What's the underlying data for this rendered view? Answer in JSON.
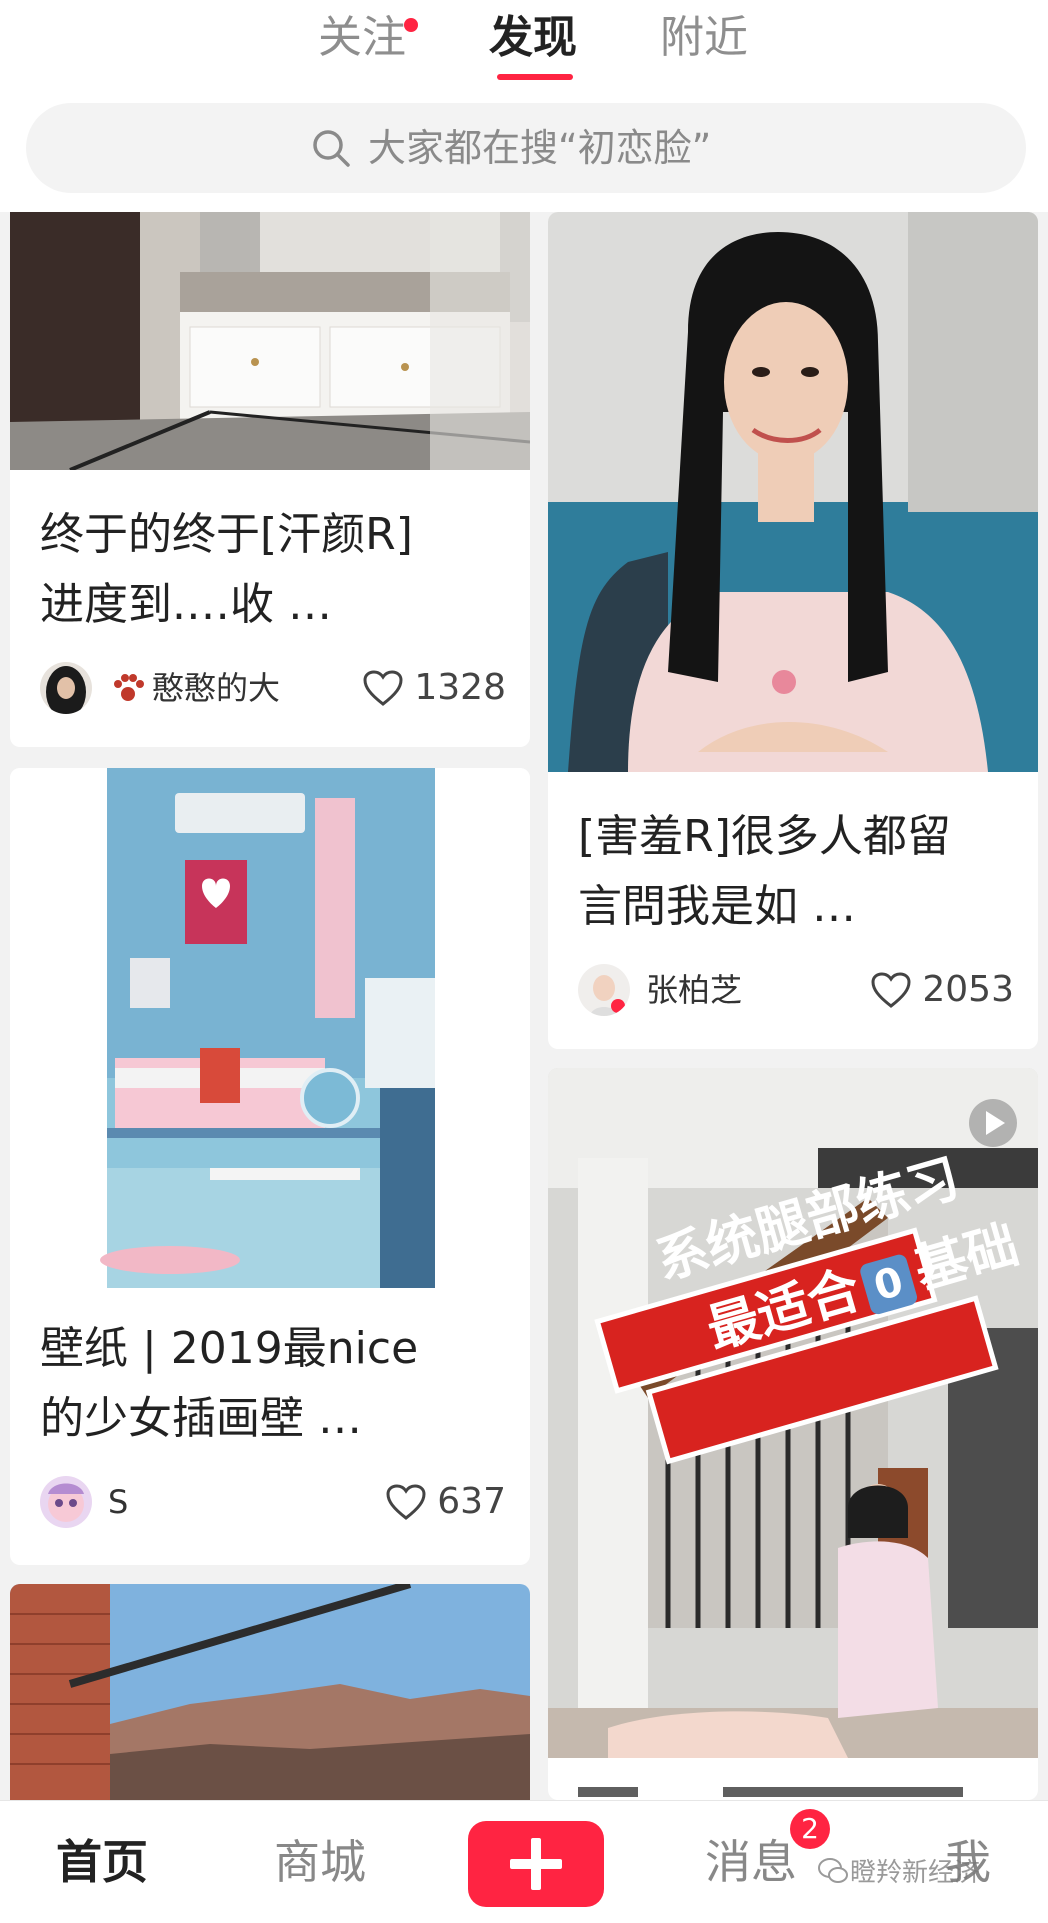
{
  "tabs": {
    "follow": "关注",
    "discover": "发现",
    "nearby": "附近"
  },
  "search": {
    "placeholder": "大家都在搜“初恋脸”"
  },
  "cards": [
    {
      "title_line1": "终于的终于[汗颜R]",
      "title_line2": "进度到.…收 …",
      "author": "憨憨的大",
      "likes": "1328"
    },
    {
      "title_line1": "[害羞R]很多人都留",
      "title_line2": "言問我是如 …",
      "author": "张柏芝",
      "likes": "2053"
    },
    {
      "title_line1": "壁纸 | 2019最nice",
      "title_line2": "的少女插画壁 …",
      "author": "S",
      "likes": "637"
    },
    {
      "overlay_line1": "系统腿部练习",
      "overlay_line2": "最适合",
      "overlay_zero": "0",
      "overlay_line3": "基础"
    }
  ],
  "nav": {
    "home": "首页",
    "mall": "商城",
    "messages": "消息",
    "messages_badge": "2",
    "me": "我"
  },
  "watermark": "瞪羚新经济",
  "colors": {
    "accent": "#ff2442"
  }
}
